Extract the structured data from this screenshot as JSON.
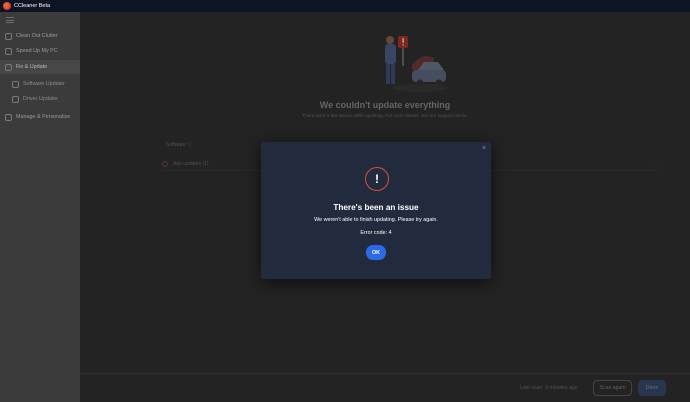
{
  "window": {
    "title": "CCleaner Beta"
  },
  "sidebar": {
    "items": [
      {
        "label": "Clean Out Clutter",
        "icon": "broom-icon"
      },
      {
        "label": "Speed Up My PC",
        "icon": "speedometer-icon"
      },
      {
        "label": "Fix & Update",
        "icon": "wrench-icon",
        "active": true
      },
      {
        "label": "Software Updater",
        "icon": "package-icon",
        "sub": true
      },
      {
        "label": "Driver Updater",
        "icon": "driver-icon",
        "sub": true
      },
      {
        "label": "Manage & Personalize",
        "icon": "settings-icon"
      }
    ]
  },
  "main": {
    "headline": "We couldn't update everything",
    "subline": "There were a few issues while updating. For more details, see our support article.",
    "column_header": "Software ⓘ",
    "app_row_label": "App updates (1)"
  },
  "footer": {
    "last_scan": "Last scan: 8 minutes ago",
    "scan_again": "Scan again",
    "done": "Done"
  },
  "modal": {
    "close": "×",
    "warning_glyph": "!",
    "title": "There's been an issue",
    "message": "We weren't able to finish updating. Please try again.",
    "error_code": "Error code: 4",
    "ok": "OK"
  },
  "colors": {
    "accent": "#2a6ae8",
    "warning": "#e14b3b",
    "modal_bg": "#222a3d",
    "titlebar_bg": "#0d1424"
  }
}
